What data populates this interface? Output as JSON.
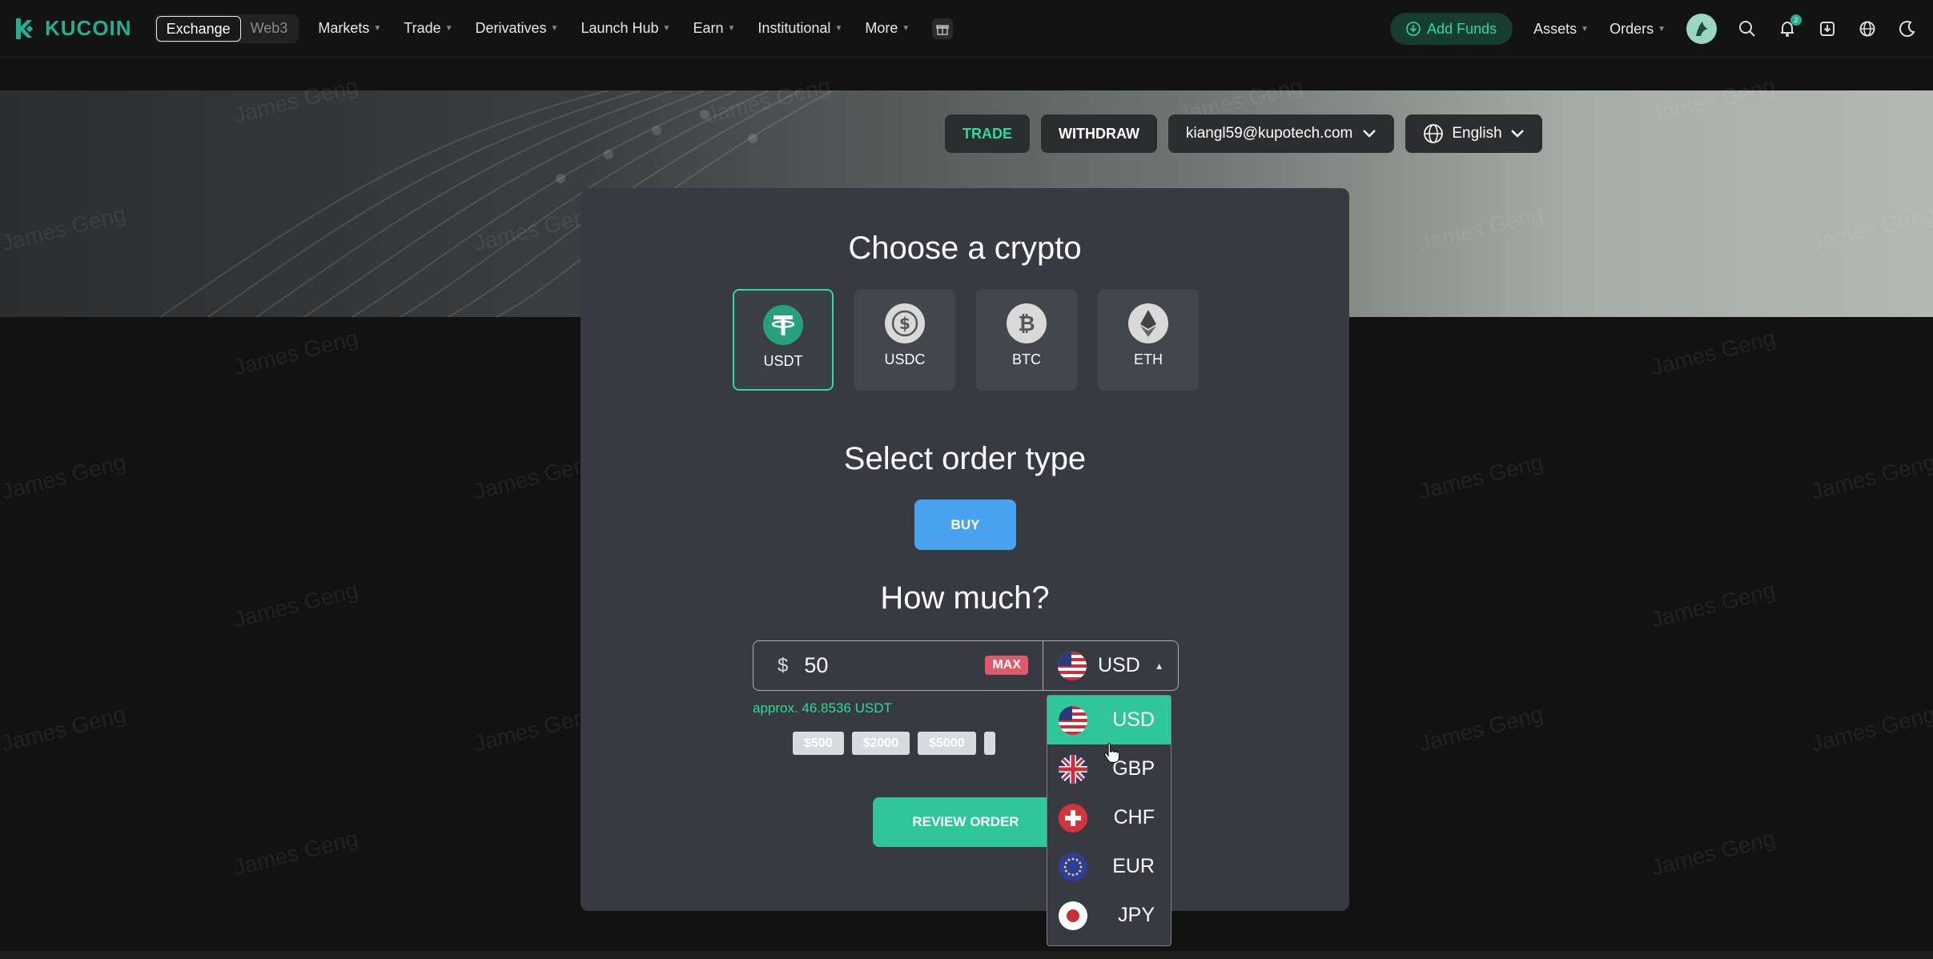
{
  "nav": {
    "logo_text": "KUCOIN",
    "segments": [
      "Exchange",
      "Web3"
    ],
    "links": [
      "Markets",
      "Trade",
      "Derivatives",
      "Launch Hub",
      "Earn",
      "Institutional",
      "More"
    ],
    "add_funds": "Add Funds",
    "assets": "Assets",
    "orders": "Orders",
    "notification_count": "2",
    "accent_color": "#24ae8f"
  },
  "actions": {
    "trade": "TRADE",
    "withdraw": "WITHDRAW",
    "email": "kiangl59@kupotech.com",
    "language": "English"
  },
  "card": {
    "choose_title": "Choose a crypto",
    "coins": [
      "USDT",
      "USDC",
      "BTC",
      "ETH"
    ],
    "order_title": "Select order type",
    "buy": "BUY",
    "how_much_title": "How much?",
    "currency_symbol": "$",
    "amount": "50",
    "max": "MAX",
    "currency": "USD",
    "approx": "approx. 46.8536 USDT",
    "quick_amounts": [
      "$500",
      "$2000",
      "$5000"
    ],
    "review": "REVIEW ORDER"
  },
  "dropdown": {
    "options": [
      "USD",
      "GBP",
      "CHF",
      "EUR",
      "JPY"
    ],
    "selected": "USD"
  },
  "watermark": "James Geng"
}
